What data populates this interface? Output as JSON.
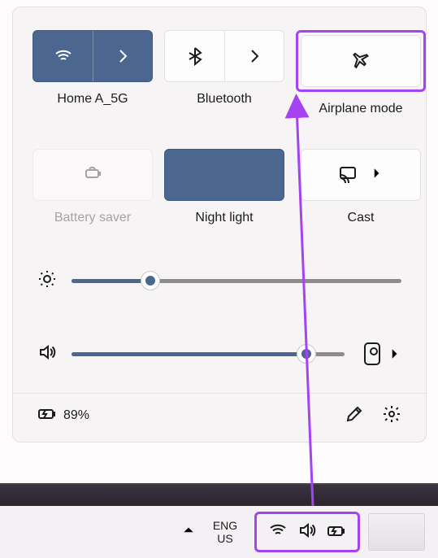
{
  "tiles": {
    "wifi": {
      "label": "Home A_5G"
    },
    "bluetooth": {
      "label": "Bluetooth"
    },
    "airplane": {
      "label": "Airplane mode"
    },
    "battery_saver": {
      "label": "Battery saver"
    },
    "night_light": {
      "label": "Night light"
    },
    "cast": {
      "label": "Cast"
    }
  },
  "sliders": {
    "brightness_pct": 24,
    "volume_pct": 86
  },
  "status": {
    "battery_text": "89%"
  },
  "taskbar": {
    "language_top": "ENG",
    "language_bottom": "US"
  }
}
